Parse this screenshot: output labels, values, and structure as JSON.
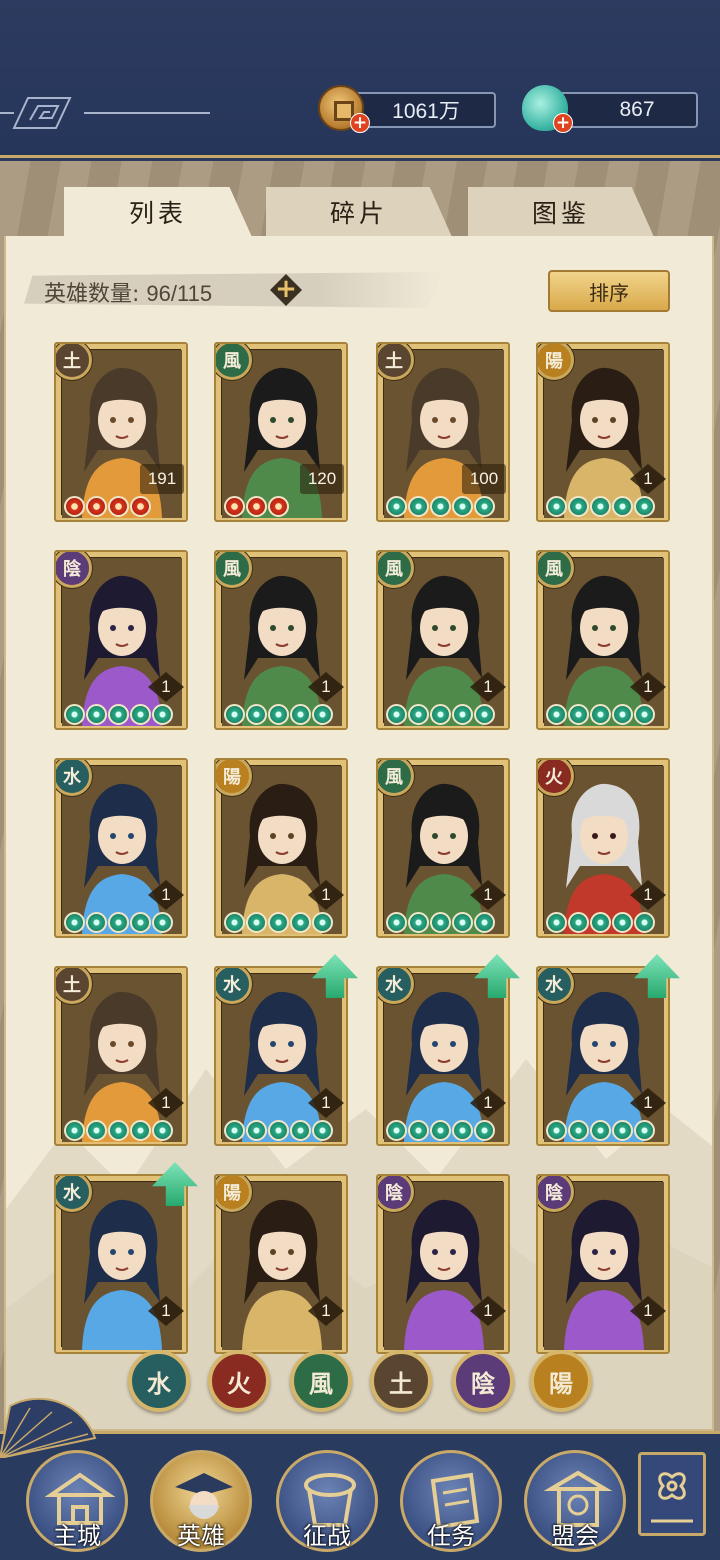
{
  "resources": {
    "gold": "1061万",
    "jade": "867",
    "gold_icon": "coin-icon",
    "jade_icon": "jade-pot-icon",
    "plus_symbol": "+"
  },
  "tabs": [
    {
      "label": "列表",
      "active": true
    },
    {
      "label": "碎片",
      "active": false
    },
    {
      "label": "图鉴",
      "active": false
    }
  ],
  "hero_count": {
    "label": "英雄数量: ",
    "value": "96/115",
    "plus_symbol": "+"
  },
  "sort_label": "排序",
  "elements": {
    "earth": {
      "glyph": "土",
      "color": "#5a4630"
    },
    "wind": {
      "glyph": "風",
      "color": "#2e6b47"
    },
    "yin": {
      "glyph": "陰",
      "color": "#5b3b78"
    },
    "yang": {
      "glyph": "陽",
      "color": "#b8801e"
    },
    "water": {
      "glyph": "水",
      "color": "#275e5f"
    },
    "fire": {
      "glyph": "火",
      "color": "#8a2b22"
    }
  },
  "heroes": [
    {
      "element": "earth",
      "glyph": "土",
      "level": "191",
      "stars": 4,
      "star_color": "red",
      "upgrade": false
    },
    {
      "element": "wind",
      "glyph": "風",
      "level": "120",
      "stars": 3,
      "star_color": "red",
      "upgrade": false
    },
    {
      "element": "earth",
      "glyph": "土",
      "level": "100",
      "stars": 5,
      "star_color": "green",
      "upgrade": false
    },
    {
      "element": "yang",
      "glyph": "陽",
      "level": "1",
      "stars": 5,
      "star_color": "green",
      "upgrade": false
    },
    {
      "element": "yin",
      "glyph": "陰",
      "level": "1",
      "stars": 5,
      "star_color": "green",
      "upgrade": false
    },
    {
      "element": "wind",
      "glyph": "風",
      "level": "1",
      "stars": 5,
      "star_color": "green",
      "upgrade": false
    },
    {
      "element": "wind",
      "glyph": "風",
      "level": "1",
      "stars": 5,
      "star_color": "green",
      "upgrade": false
    },
    {
      "element": "wind",
      "glyph": "風",
      "level": "1",
      "stars": 5,
      "star_color": "green",
      "upgrade": false
    },
    {
      "element": "water",
      "glyph": "水",
      "level": "1",
      "stars": 5,
      "star_color": "green",
      "upgrade": false
    },
    {
      "element": "yang",
      "glyph": "陽",
      "level": "1",
      "stars": 5,
      "star_color": "green",
      "upgrade": false
    },
    {
      "element": "wind",
      "glyph": "風",
      "level": "1",
      "stars": 5,
      "star_color": "green",
      "upgrade": false
    },
    {
      "element": "fire",
      "glyph": "火",
      "level": "1",
      "stars": 5,
      "star_color": "green",
      "upgrade": false
    },
    {
      "element": "earth",
      "glyph": "土",
      "level": "1",
      "stars": 5,
      "star_color": "green",
      "upgrade": false
    },
    {
      "element": "water",
      "glyph": "水",
      "level": "1",
      "stars": 5,
      "star_color": "green",
      "upgrade": true
    },
    {
      "element": "water",
      "glyph": "水",
      "level": "1",
      "stars": 5,
      "star_color": "green",
      "upgrade": true
    },
    {
      "element": "water",
      "glyph": "水",
      "level": "1",
      "stars": 5,
      "star_color": "green",
      "upgrade": true
    },
    {
      "element": "water",
      "glyph": "水",
      "level": "1",
      "stars": 0,
      "star_color": "green",
      "upgrade": true
    },
    {
      "element": "yang",
      "glyph": "陽",
      "level": "1",
      "stars": 0,
      "star_color": "green",
      "upgrade": false
    },
    {
      "element": "yin",
      "glyph": "陰",
      "level": "1",
      "stars": 0,
      "star_color": "green",
      "upgrade": false
    },
    {
      "element": "yin",
      "glyph": "陰",
      "level": "1",
      "stars": 0,
      "star_color": "green",
      "upgrade": false
    }
  ],
  "filters": [
    {
      "element": "water",
      "glyph": "水"
    },
    {
      "element": "fire",
      "glyph": "火"
    },
    {
      "element": "wind",
      "glyph": "風"
    },
    {
      "element": "earth",
      "glyph": "土"
    },
    {
      "element": "yin",
      "glyph": "陰"
    },
    {
      "element": "yang",
      "glyph": "陽"
    }
  ],
  "nav": [
    {
      "label": "主城",
      "icon": "city-gate-icon",
      "active": false
    },
    {
      "label": "英雄",
      "icon": "hero-portrait-icon",
      "active": true
    },
    {
      "label": "征战",
      "icon": "war-scroll-icon",
      "active": false
    },
    {
      "label": "任务",
      "icon": "task-book-icon",
      "active": false
    },
    {
      "label": "盟会",
      "icon": "alliance-pavilion-icon",
      "active": false
    }
  ],
  "menu_icon": "menu-flower-icon"
}
